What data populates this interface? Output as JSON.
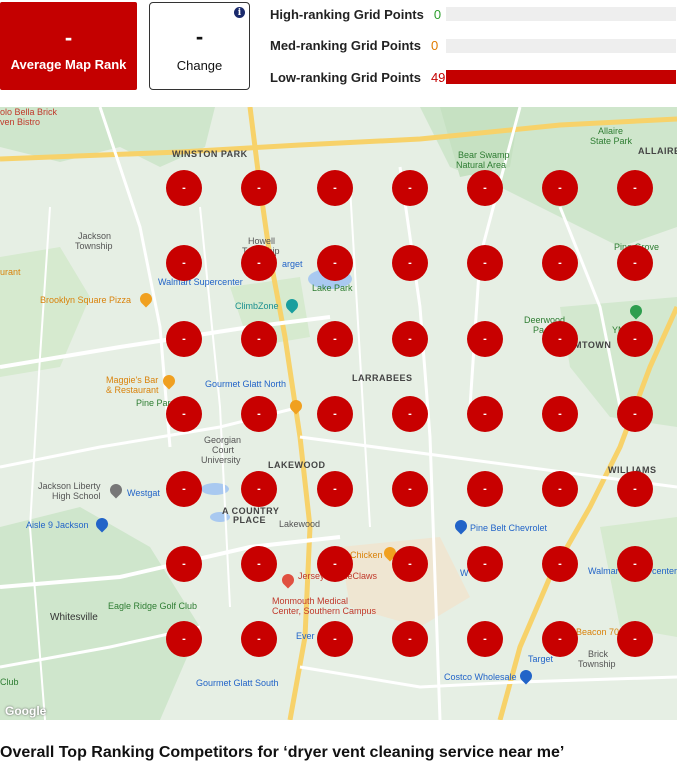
{
  "summary": {
    "average_map_rank_value": "-",
    "average_map_rank_label": "Average Map Rank",
    "change_value": "-",
    "change_label": "Change",
    "info_icon": "i"
  },
  "grid_points": [
    {
      "label": "High-ranking Grid Points",
      "count": "0",
      "color": "#2e9e2e",
      "fraction": 0
    },
    {
      "label": "Med-ranking Grid Points",
      "count": "0",
      "color": "#e07b00",
      "fraction": 0
    },
    {
      "label": "Low-ranking Grid Points",
      "count": "49",
      "color": "#c40000",
      "fraction": 1
    }
  ],
  "map": {
    "labels": {
      "bella_brick": "olo Bella Brick",
      "bella_bistro": "ven Bistro",
      "winston_park": "WINSTON PARK",
      "bear_swamp": "Bear Swamp",
      "natural_area": "Natural Area",
      "allaire": "Allaire",
      "state_park": "State Park",
      "allaire_caps": "ALLAIRE",
      "jackson_township_1": "Jackson",
      "jackson_township_2": "Township",
      "howell_township_1": "Howell",
      "howell_township_2": "Township",
      "target_1": "arget",
      "pine_grove": "Pine Grove",
      "urant": "urant",
      "walmart_supercenter": "Walmart Supercenter",
      "lake_park": "Lake Park",
      "brooklyn_square_pizza": "Brooklyn Square Pizza",
      "climbzone": "ClimbZone",
      "deerwood": "Deerwood",
      "deerwood_park": "Pa",
      "mtown": "MTOWN",
      "ymca": "YM    mp",
      "maggies_bar": "Maggie's Bar",
      "restaurant": "& Restaurant",
      "pine_park": "Pine Par",
      "gourmet_glatt_north": "Gourmet Glatt North",
      "larrabees": "LARRABEES",
      "georgian_court_1": "Georgian",
      "georgian_court_2": "Court",
      "georgian_court_3": "University",
      "lakewood_caps": "LAKEWOOD",
      "williams": "WILLIAMS",
      "jackson_liberty_1": "Jackson Liberty",
      "jackson_liberty_2": "High School",
      "westgate": "Westgat",
      "country_place_1": "A COUNTRY",
      "country_place_2": "PLACE",
      "lakewood": "Lakewood",
      "aisle_9": "Aisle 9 Jackson",
      "pine_belt_chevrolet": "Pine Belt Chevrolet",
      "chicken": "Chicken",
      "jersey_blueclaws": "Jersey      e BlueClaws",
      "walmart_1": "W",
      "walmart_2": "Walmar",
      "center": "center",
      "eagle_ridge": "Eagle Ridge Golf Club",
      "whitesville": "Whitesville",
      "monmouth_1": "Monmouth Medical",
      "monmouth_2": "Center, Southern Campus",
      "ever_kosher": "Ever        sher Mar",
      "beacon_70": "Beacon 70",
      "target_2": "Target",
      "brick_1": "Brick",
      "brick_2": "Township",
      "club": "Club",
      "gourmet_glatt_south": "Gourmet Glatt South",
      "costco": "Costco Wholesale",
      "google": "Google"
    },
    "grid_rank_marker": "-"
  },
  "competitors_title": "Overall Top Ranking Competitors for ‘dryer vent cleaning service near me’"
}
